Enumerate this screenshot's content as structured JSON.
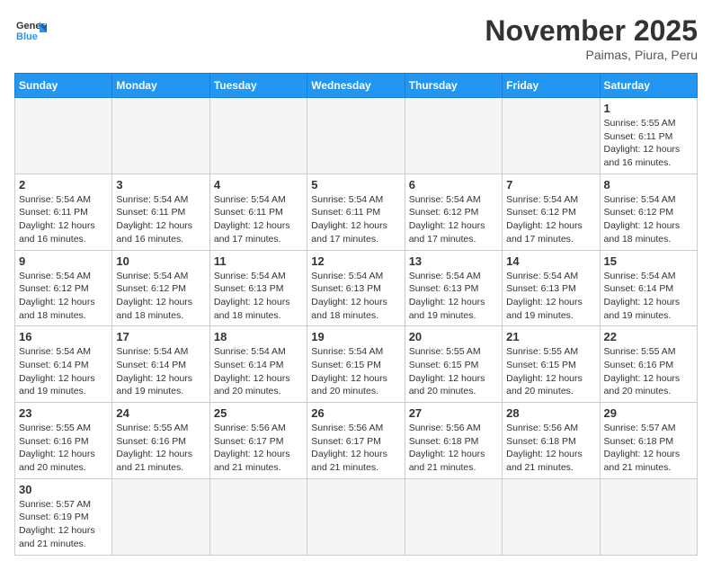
{
  "header": {
    "logo_general": "General",
    "logo_blue": "Blue",
    "month_title": "November 2025",
    "location": "Paimas, Piura, Peru"
  },
  "days_of_week": [
    "Sunday",
    "Monday",
    "Tuesday",
    "Wednesday",
    "Thursday",
    "Friday",
    "Saturday"
  ],
  "weeks": [
    [
      {
        "day": "",
        "info": ""
      },
      {
        "day": "",
        "info": ""
      },
      {
        "day": "",
        "info": ""
      },
      {
        "day": "",
        "info": ""
      },
      {
        "day": "",
        "info": ""
      },
      {
        "day": "",
        "info": ""
      },
      {
        "day": "1",
        "info": "Sunrise: 5:55 AM\nSunset: 6:11 PM\nDaylight: 12 hours and 16 minutes."
      }
    ],
    [
      {
        "day": "2",
        "info": "Sunrise: 5:54 AM\nSunset: 6:11 PM\nDaylight: 12 hours and 16 minutes."
      },
      {
        "day": "3",
        "info": "Sunrise: 5:54 AM\nSunset: 6:11 PM\nDaylight: 12 hours and 16 minutes."
      },
      {
        "day": "4",
        "info": "Sunrise: 5:54 AM\nSunset: 6:11 PM\nDaylight: 12 hours and 17 minutes."
      },
      {
        "day": "5",
        "info": "Sunrise: 5:54 AM\nSunset: 6:11 PM\nDaylight: 12 hours and 17 minutes."
      },
      {
        "day": "6",
        "info": "Sunrise: 5:54 AM\nSunset: 6:12 PM\nDaylight: 12 hours and 17 minutes."
      },
      {
        "day": "7",
        "info": "Sunrise: 5:54 AM\nSunset: 6:12 PM\nDaylight: 12 hours and 17 minutes."
      },
      {
        "day": "8",
        "info": "Sunrise: 5:54 AM\nSunset: 6:12 PM\nDaylight: 12 hours and 18 minutes."
      }
    ],
    [
      {
        "day": "9",
        "info": "Sunrise: 5:54 AM\nSunset: 6:12 PM\nDaylight: 12 hours and 18 minutes."
      },
      {
        "day": "10",
        "info": "Sunrise: 5:54 AM\nSunset: 6:12 PM\nDaylight: 12 hours and 18 minutes."
      },
      {
        "day": "11",
        "info": "Sunrise: 5:54 AM\nSunset: 6:13 PM\nDaylight: 12 hours and 18 minutes."
      },
      {
        "day": "12",
        "info": "Sunrise: 5:54 AM\nSunset: 6:13 PM\nDaylight: 12 hours and 18 minutes."
      },
      {
        "day": "13",
        "info": "Sunrise: 5:54 AM\nSunset: 6:13 PM\nDaylight: 12 hours and 19 minutes."
      },
      {
        "day": "14",
        "info": "Sunrise: 5:54 AM\nSunset: 6:13 PM\nDaylight: 12 hours and 19 minutes."
      },
      {
        "day": "15",
        "info": "Sunrise: 5:54 AM\nSunset: 6:14 PM\nDaylight: 12 hours and 19 minutes."
      }
    ],
    [
      {
        "day": "16",
        "info": "Sunrise: 5:54 AM\nSunset: 6:14 PM\nDaylight: 12 hours and 19 minutes."
      },
      {
        "day": "17",
        "info": "Sunrise: 5:54 AM\nSunset: 6:14 PM\nDaylight: 12 hours and 19 minutes."
      },
      {
        "day": "18",
        "info": "Sunrise: 5:54 AM\nSunset: 6:14 PM\nDaylight: 12 hours and 20 minutes."
      },
      {
        "day": "19",
        "info": "Sunrise: 5:54 AM\nSunset: 6:15 PM\nDaylight: 12 hours and 20 minutes."
      },
      {
        "day": "20",
        "info": "Sunrise: 5:55 AM\nSunset: 6:15 PM\nDaylight: 12 hours and 20 minutes."
      },
      {
        "day": "21",
        "info": "Sunrise: 5:55 AM\nSunset: 6:15 PM\nDaylight: 12 hours and 20 minutes."
      },
      {
        "day": "22",
        "info": "Sunrise: 5:55 AM\nSunset: 6:16 PM\nDaylight: 12 hours and 20 minutes."
      }
    ],
    [
      {
        "day": "23",
        "info": "Sunrise: 5:55 AM\nSunset: 6:16 PM\nDaylight: 12 hours and 20 minutes."
      },
      {
        "day": "24",
        "info": "Sunrise: 5:55 AM\nSunset: 6:16 PM\nDaylight: 12 hours and 21 minutes."
      },
      {
        "day": "25",
        "info": "Sunrise: 5:56 AM\nSunset: 6:17 PM\nDaylight: 12 hours and 21 minutes."
      },
      {
        "day": "26",
        "info": "Sunrise: 5:56 AM\nSunset: 6:17 PM\nDaylight: 12 hours and 21 minutes."
      },
      {
        "day": "27",
        "info": "Sunrise: 5:56 AM\nSunset: 6:18 PM\nDaylight: 12 hours and 21 minutes."
      },
      {
        "day": "28",
        "info": "Sunrise: 5:56 AM\nSunset: 6:18 PM\nDaylight: 12 hours and 21 minutes."
      },
      {
        "day": "29",
        "info": "Sunrise: 5:57 AM\nSunset: 6:18 PM\nDaylight: 12 hours and 21 minutes."
      }
    ],
    [
      {
        "day": "30",
        "info": "Sunrise: 5:57 AM\nSunset: 6:19 PM\nDaylight: 12 hours and 21 minutes."
      },
      {
        "day": "",
        "info": ""
      },
      {
        "day": "",
        "info": ""
      },
      {
        "day": "",
        "info": ""
      },
      {
        "day": "",
        "info": ""
      },
      {
        "day": "",
        "info": ""
      },
      {
        "day": "",
        "info": ""
      }
    ]
  ]
}
